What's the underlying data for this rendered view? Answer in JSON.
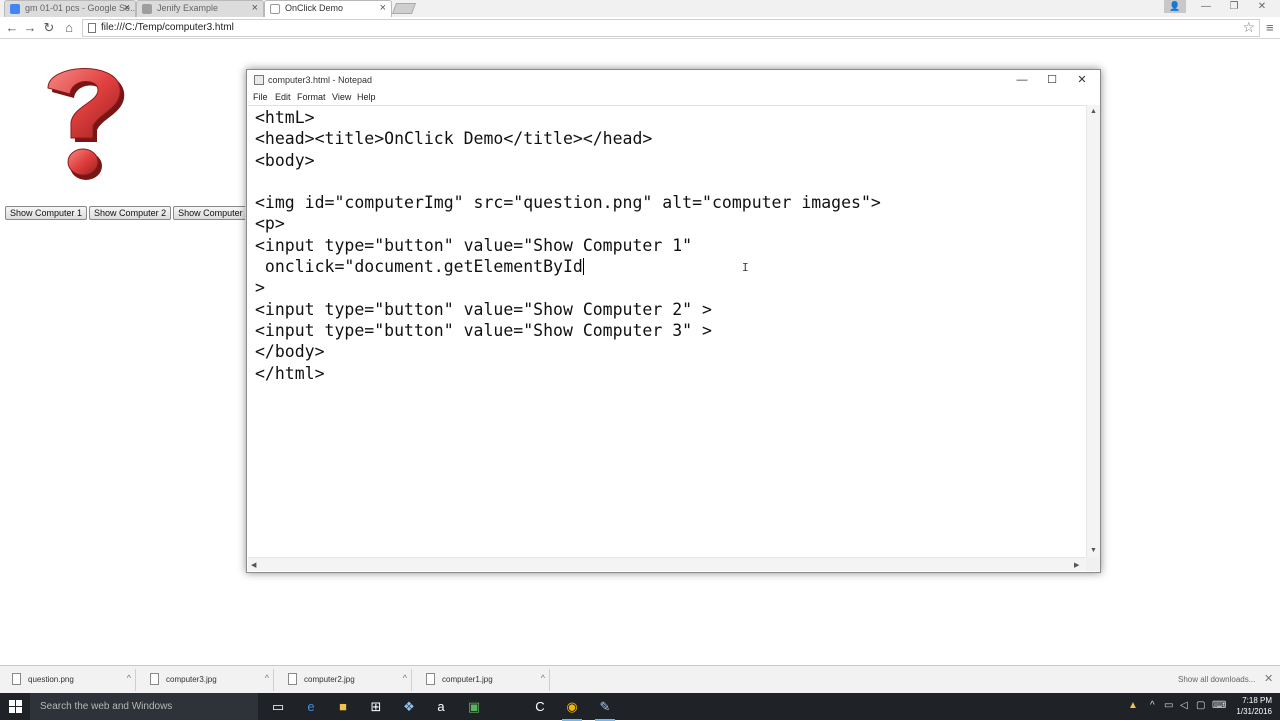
{
  "browser": {
    "tabs": [
      {
        "label": "gm 01-01 pcs - Google Se..",
        "active": false
      },
      {
        "label": "Jenify Example",
        "active": false
      },
      {
        "label": "OnClick Demo",
        "active": true
      }
    ],
    "url": "file:///C:/Temp/computer3.html"
  },
  "page": {
    "image_alt": "question mark image",
    "buttons": [
      "Show Computer 1",
      "Show Computer 2",
      "Show Computer 3"
    ]
  },
  "notepad": {
    "title": "computer3.html - Notepad",
    "menus": [
      "File",
      "Edit",
      "Format",
      "View",
      "Help"
    ],
    "code_lines": [
      "<htmL>",
      "<head><title>OnClick Demo</title></head>",
      "<body>",
      "",
      "<img id=\"computerImg\" src=\"question.png\" alt=\"computer images\">",
      "<p>",
      "<input type=\"button\" value=\"Show Computer 1\"",
      " onclick=\"document.getElementById",
      ">",
      "<input type=\"button\" value=\"Show Computer 2\" >",
      "<input type=\"button\" value=\"Show Computer 3\" >",
      "</body>",
      "</html>"
    ]
  },
  "downloads": {
    "items": [
      "question.png",
      "computer3.jpg",
      "computer2.jpg",
      "computer1.jpg"
    ],
    "show_all": "Show all downloads..."
  },
  "taskbar": {
    "search_placeholder": "Search the web and Windows",
    "time": "7:18 PM",
    "date": "1/31/2016"
  },
  "colors": {
    "taskbar": "#1f2327",
    "question_mark": "#e0403f",
    "taskbar_active_indicator": "#76b9ed"
  }
}
